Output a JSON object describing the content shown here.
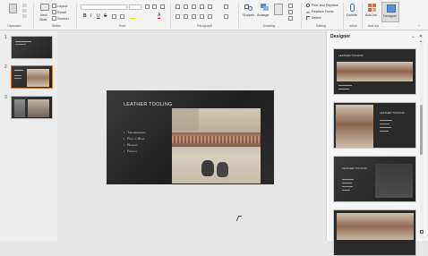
{
  "ribbon": {
    "groups": {
      "clipboard": "Clipboard",
      "slides": "Slides",
      "font": "Font",
      "paragraph": "Paragraph",
      "drawing": "Drawing",
      "editing": "Editing",
      "voice": "Voice",
      "add_ins": "Add-ins"
    },
    "slides_group": {
      "new_slide": "New",
      "new_slide_2": "Slide",
      "layout": "Layout",
      "reset": "Reset",
      "section": "Section"
    },
    "drawing_group": {
      "shapes": "Shapes",
      "arrange": "Arrange"
    },
    "editing_group": {
      "find_replace": "Find and Replace",
      "replace_fonts": "Replace Fonts",
      "select": "Select"
    },
    "voice_group": {
      "dictate": "Dictate"
    },
    "addins_group": {
      "addins": "Add-ins",
      "designer": "Designer"
    }
  },
  "thumbnails": {
    "items": [
      {
        "num": "1"
      },
      {
        "num": "2"
      },
      {
        "num": "3"
      }
    ]
  },
  "slide": {
    "title": "LEATHER TOOLING",
    "bullets": [
      "Time management",
      "Piece of Work",
      "Relaxing",
      "Patience"
    ]
  },
  "designer": {
    "title": "Designer",
    "card_titles": [
      "LEATHER TOOLING",
      "LEATHER TOOLING",
      "LEATHER TOOLING"
    ]
  },
  "icons": {
    "minimize": "minimize-icon",
    "close": "close-icon",
    "chevron_down": "chevron-down-icon",
    "chevron_up": "chevron-up-icon"
  }
}
